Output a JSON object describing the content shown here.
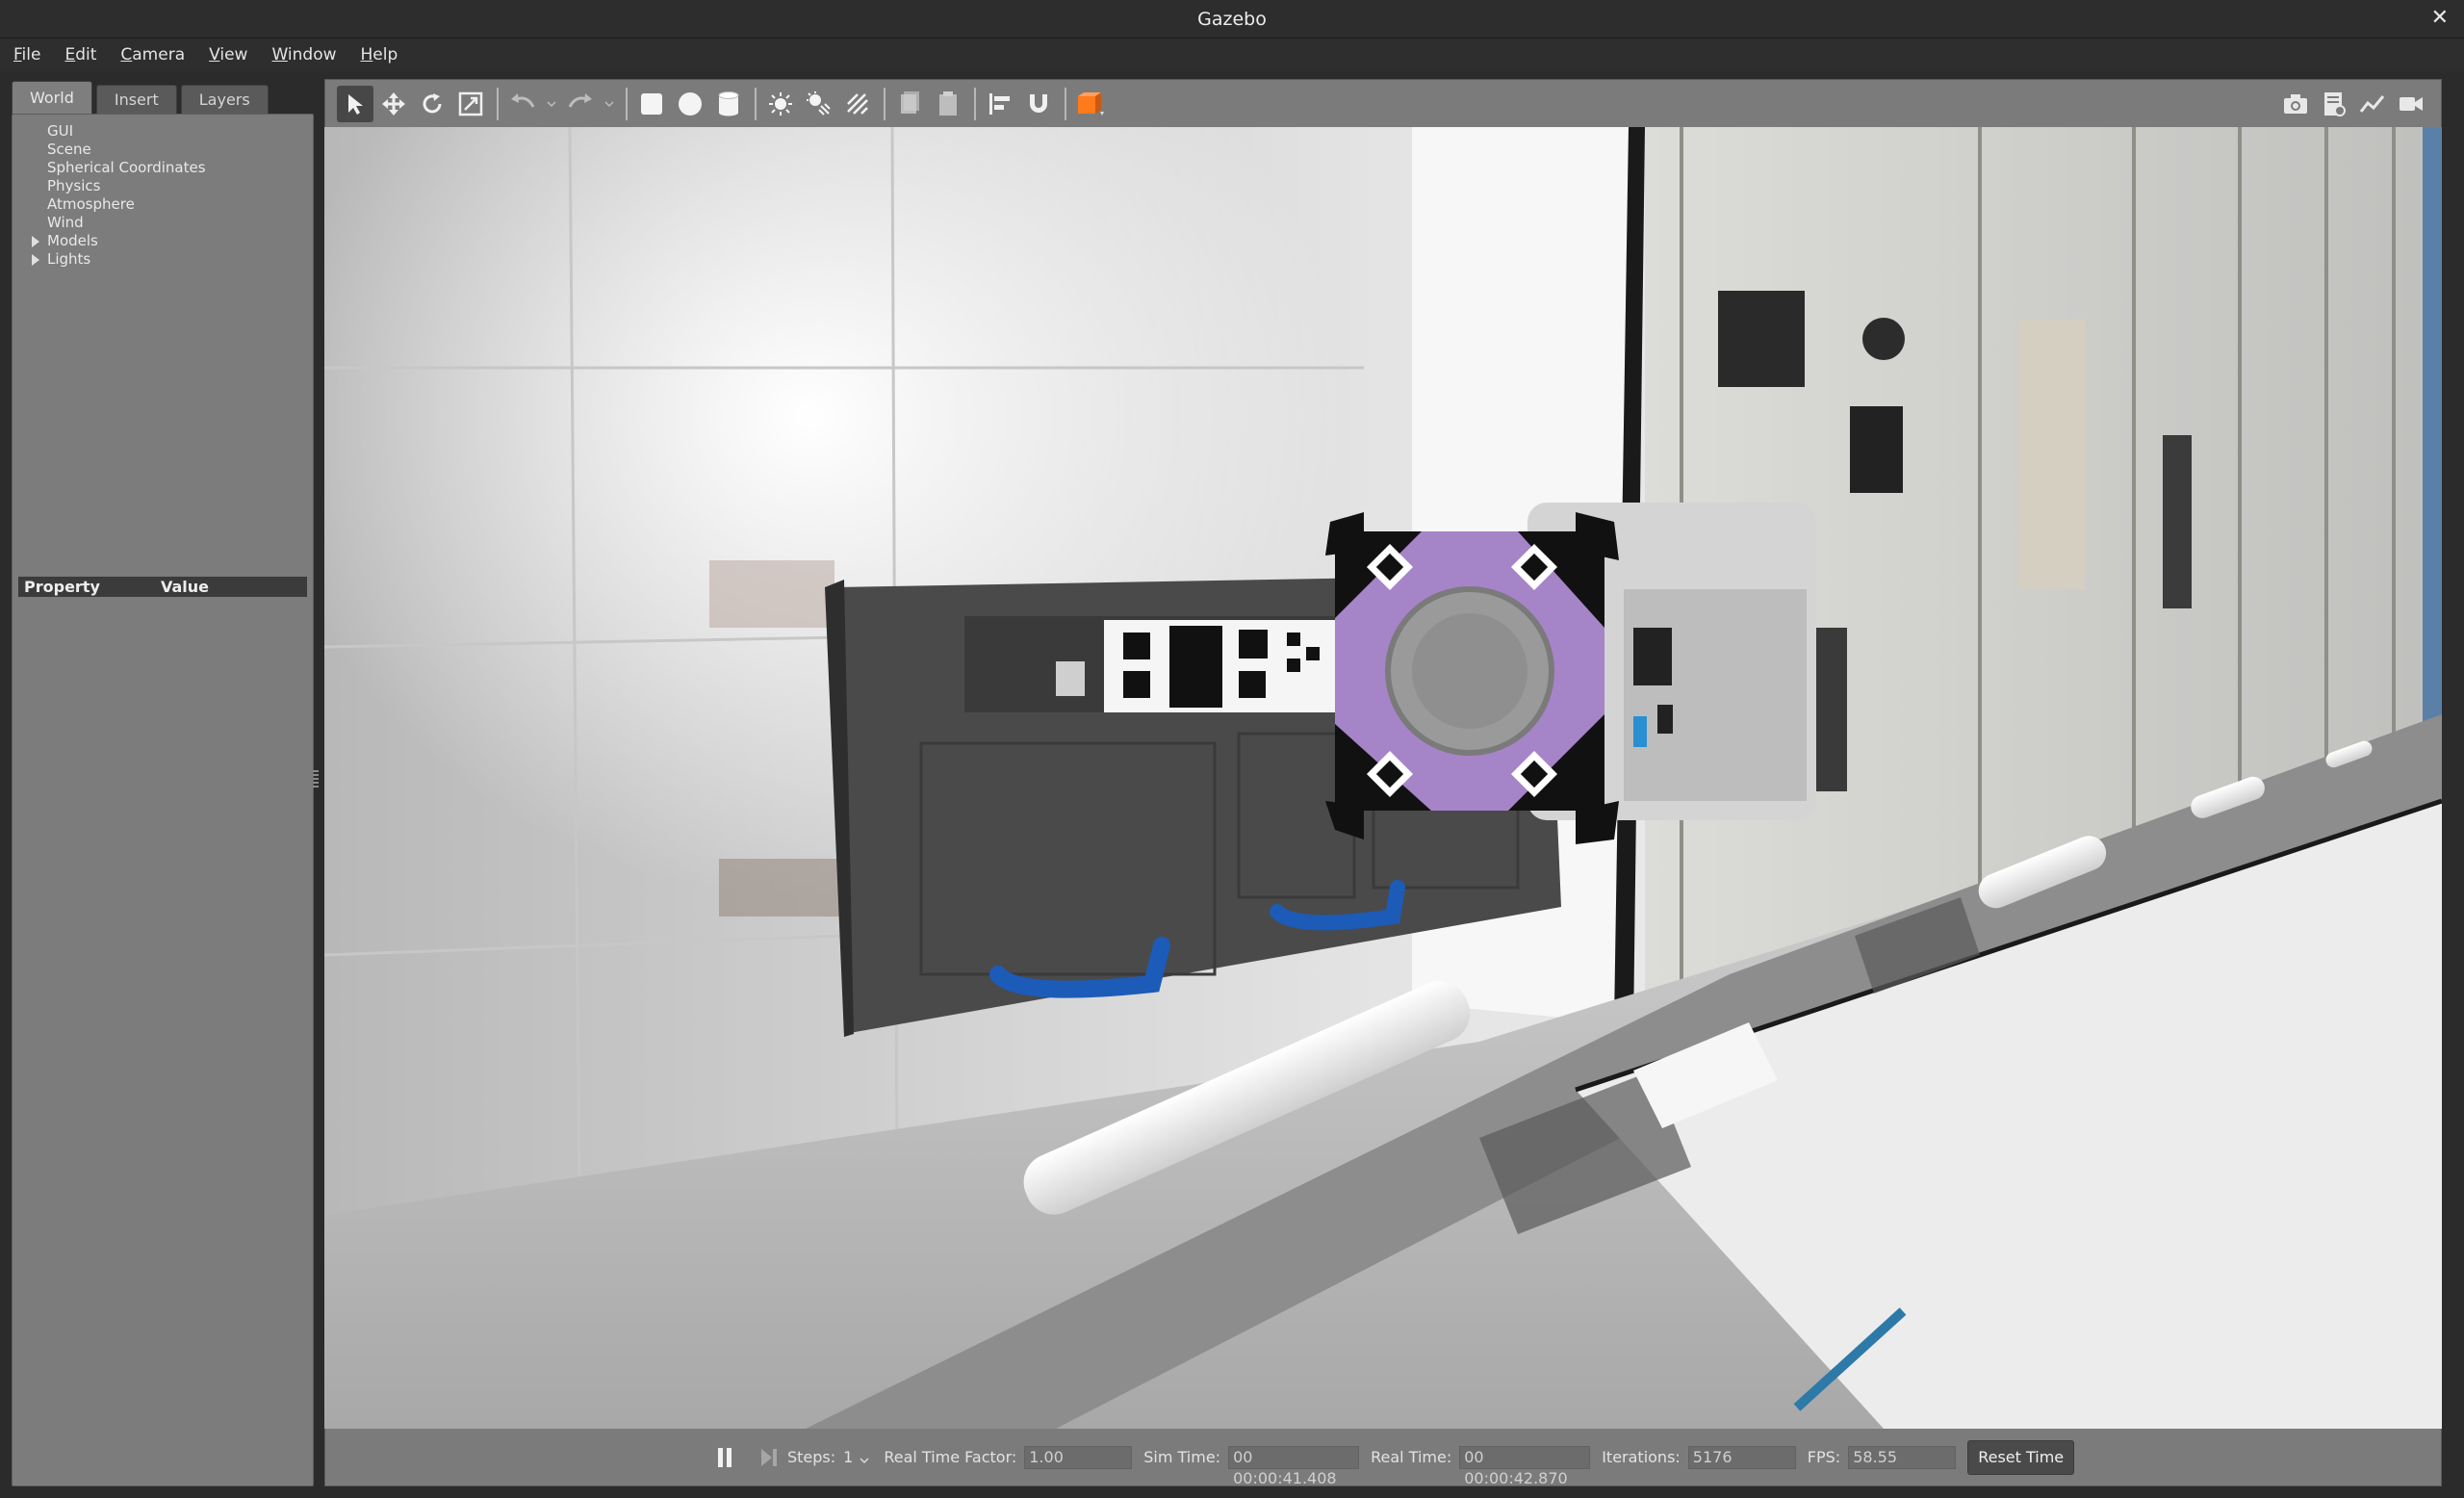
{
  "window": {
    "title": "Gazebo"
  },
  "menu": [
    {
      "accel": "F",
      "rest": "ile"
    },
    {
      "accel": "E",
      "rest": "dit"
    },
    {
      "accel": "C",
      "rest": "amera"
    },
    {
      "accel": "V",
      "rest": "iew"
    },
    {
      "accel": "W",
      "rest": "indow"
    },
    {
      "accel": "H",
      "rest": "elp"
    }
  ],
  "left_panel": {
    "tabs": [
      "World",
      "Insert",
      "Layers"
    ],
    "active_tab": "World",
    "tree": [
      "GUI",
      "Scene",
      "Spherical Coordinates",
      "Physics",
      "Atmosphere",
      "Wind",
      "Models",
      "Lights"
    ],
    "property_header": {
      "property": "Property",
      "value": "Value"
    }
  },
  "toolbar": {
    "left_tools": [
      "select-arrow-icon",
      "translate-icon",
      "rotate-icon",
      "scale-icon",
      "undo-icon",
      "redo-icon",
      "box-shape-icon",
      "sphere-shape-icon",
      "cylinder-shape-icon",
      "point-light-icon",
      "spot-light-icon",
      "directional-light-icon",
      "copy-icon",
      "paste-icon",
      "align-icon",
      "snap-icon",
      "view-angle-icon"
    ],
    "right_tools": [
      "screenshot-icon",
      "log-icon",
      "plot-icon",
      "record-video-icon"
    ]
  },
  "bottom_bar": {
    "steps_label": "Steps:",
    "steps_value": "1",
    "rtf_label": "Real Time Factor:",
    "rtf_value": "1.00",
    "sim_time_label": "Sim Time:",
    "sim_time_value": "00 00:00:41.408",
    "real_time_label": "Real Time:",
    "real_time_value": "00 00:00:42.870",
    "iterations_label": "Iterations:",
    "iterations_value": "5176",
    "fps_label": "FPS:",
    "fps_value": "58.55",
    "reset_label": "Reset Time"
  },
  "colors": {
    "robot_panel": "#a684c8",
    "handle": "#1c5bb8",
    "accent_orange": "#ff7a1a"
  }
}
